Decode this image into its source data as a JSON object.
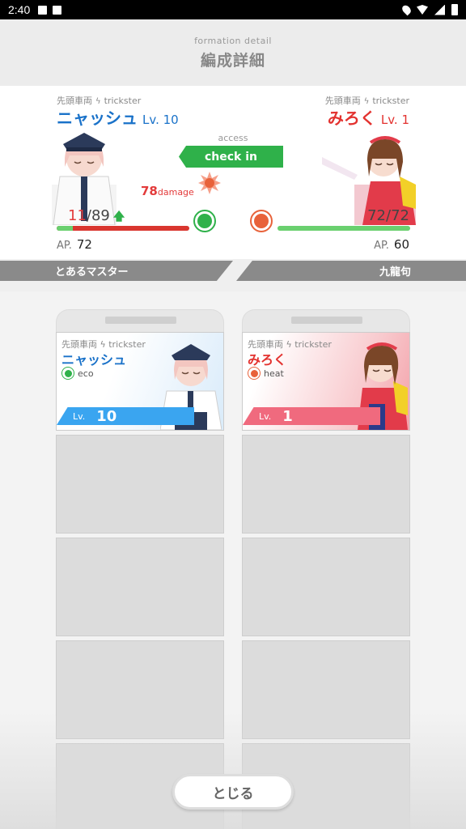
{
  "status_bar": {
    "time": "2:40"
  },
  "header": {
    "subtitle": "formation detail",
    "title": "編成詳細"
  },
  "battle": {
    "left": {
      "tag_prefix": "先頭車両",
      "tag_type": "trickster",
      "name": "ニャッシュ",
      "level": "Lv. 10",
      "hp_current": "11",
      "hp_sep": "/",
      "hp_max": "89",
      "hp_fraction": 0.124,
      "heal_fraction": 0.124,
      "element": "eco",
      "ap_label": "AP.",
      "ap_value": "72"
    },
    "right": {
      "tag_prefix": "先頭車両",
      "tag_type": "trickster",
      "name": "みろく",
      "level": "Lv. 1",
      "hp_current": "72",
      "hp_sep": "/",
      "hp_max": "72",
      "hp_fraction": 1.0,
      "element": "heat",
      "ap_label": "AP.",
      "ap_value": "60"
    },
    "access_label": "access",
    "checkin_label": "check in",
    "damage_value": "78",
    "damage_unit": "damage",
    "up_arrow": "🡅"
  },
  "players": {
    "left": "とあるマスター",
    "right": "九龍句"
  },
  "formation": {
    "left_card": {
      "tag": "先頭車両 ϟ trickster",
      "name": "ニャッシュ",
      "element": "eco",
      "lv_label": "Lv.",
      "lv_value": "10"
    },
    "right_card": {
      "tag": "先頭車両 ϟ trickster",
      "name": "みろく",
      "element": "heat",
      "lv_label": "Lv.",
      "lv_value": "1"
    }
  },
  "close_button": "とじる",
  "colors": {
    "eco": "#2fb14a",
    "heat": "#e8623a",
    "left_name": "#1a72c9",
    "right_name": "#e3322f"
  }
}
